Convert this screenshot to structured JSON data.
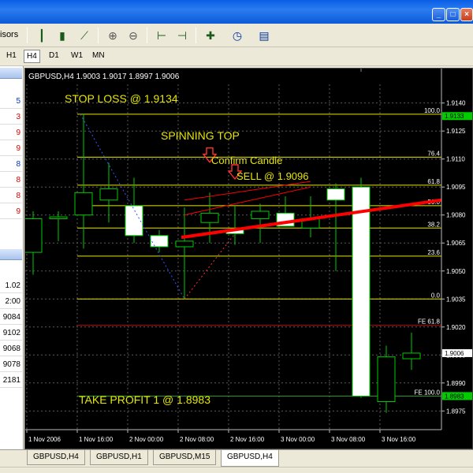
{
  "toolbar": {
    "left_text": "isors"
  },
  "timeframes": [
    "H1",
    "H4",
    "D1",
    "W1",
    "MN"
  ],
  "left_panel": {
    "col_a": [
      "5",
      "3",
      "9",
      "9",
      "8",
      "8",
      "8",
      "9"
    ],
    "col_b": [
      "1.02",
      "2:00",
      "9084",
      "9102",
      "9068",
      "9078",
      "2181"
    ]
  },
  "chart_data": {
    "type": "candlestick",
    "header": "GBPUSD,H4  1.9003 1.9017 1.8997 1.9006",
    "ylim": [
      1.8965,
      1.915
    ],
    "y_ticks": [
      "1.9140",
      "1.9125",
      "1.9110",
      "1.9095",
      "1.9080",
      "1.9065",
      "1.9050",
      "1.9035",
      "1.9020",
      "1.9005",
      "1.8990",
      "1.8975"
    ],
    "x_ticks": [
      "1 Nov 2006",
      "1 Nov 16:00",
      "2 Nov 00:00",
      "2 Nov 08:00",
      "2 Nov 16:00",
      "3 Nov 00:00",
      "3 Nov 08:00",
      "3 Nov 16:00"
    ],
    "candles": [
      {
        "o": 1.906,
        "h": 1.9082,
        "l": 1.9048,
        "c": 1.9078
      },
      {
        "o": 1.9078,
        "h": 1.9082,
        "l": 1.9066,
        "c": 1.9079
      },
      {
        "o": 1.908,
        "h": 1.9134,
        "l": 1.9062,
        "c": 1.9092
      },
      {
        "o": 1.9088,
        "h": 1.9108,
        "l": 1.9076,
        "c": 1.9094
      },
      {
        "o": 1.9085,
        "h": 1.91,
        "l": 1.9065,
        "c": 1.9069
      },
      {
        "o": 1.9069,
        "h": 1.9072,
        "l": 1.906,
        "c": 1.9063
      },
      {
        "o": 1.9063,
        "h": 1.9084,
        "l": 1.9035,
        "c": 1.9066
      },
      {
        "o": 1.9076,
        "h": 1.9092,
        "l": 1.9065,
        "c": 1.9081
      },
      {
        "o": 1.9072,
        "h": 1.9085,
        "l": 1.9064,
        "c": 1.907
      },
      {
        "o": 1.9078,
        "h": 1.9086,
        "l": 1.9065,
        "c": 1.9082
      },
      {
        "o": 1.9081,
        "h": 1.909,
        "l": 1.9074,
        "c": 1.9074
      },
      {
        "o": 1.9073,
        "h": 1.909,
        "l": 1.9068,
        "c": 1.9078
      },
      {
        "o": 1.9094,
        "h": 1.9097,
        "l": 1.905,
        "c": 1.9088
      },
      {
        "o": 1.9095,
        "h": 1.91,
        "l": 1.8982,
        "c": 1.8983
      },
      {
        "o": 1.898,
        "h": 1.901,
        "l": 1.8974,
        "c": 1.9004
      },
      {
        "o": 1.9003,
        "h": 1.9017,
        "l": 1.8997,
        "c": 1.9006
      }
    ],
    "fib_levels": [
      {
        "label": "100.0",
        "price": 1.9134
      },
      {
        "label": "76.4",
        "price": 1.9111
      },
      {
        "label": "61.8",
        "price": 1.9096
      },
      {
        "label": "50.0",
        "price": 1.9085
      },
      {
        "label": "38.2",
        "price": 1.9073
      },
      {
        "label": "23.6",
        "price": 1.9058
      },
      {
        "label": "0.0",
        "price": 1.9035
      }
    ],
    "fe_levels": [
      {
        "label": "FE 61.8",
        "price": 1.9021
      },
      {
        "label": "FE 100.0",
        "price": 1.8983
      }
    ],
    "price_labels": [
      {
        "text": "1.9133",
        "price": 1.9133,
        "color": "#00cc00"
      },
      {
        "text": "1.9006",
        "price": 1.9006,
        "color": "#ffffff"
      },
      {
        "text": "1.8983",
        "price": 1.8983,
        "color": "#00cc00"
      }
    ],
    "annotations": [
      {
        "text": "STOP LOSS @ 1.9134"
      },
      {
        "text": "SPINNING TOP"
      },
      {
        "text": "Confirm Candle"
      },
      {
        "text": "SELL @ 1.9096"
      },
      {
        "text": "TAKE PROFIT 1 @ 1.8983"
      }
    ]
  },
  "tabs": [
    "GBPUSD,H4",
    "GBPUSD,H1",
    "GBPUSD,M15",
    "GBPUSD,H4"
  ],
  "colors": {
    "candle_up": "#000000",
    "candle_down": "#ffffff",
    "wick": "#00cc00",
    "fib": "#e6e600",
    "fe": "#c80000",
    "trend": "#ff0000",
    "grid": "#5a5a5a",
    "annotation": "#e6e600"
  }
}
